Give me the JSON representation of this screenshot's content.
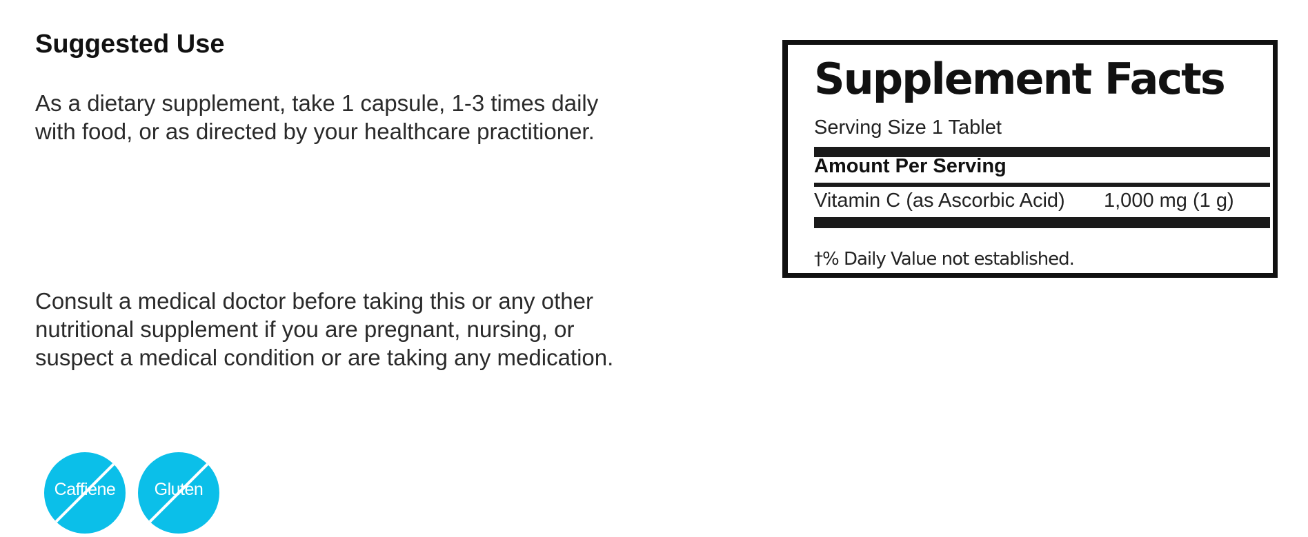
{
  "suggested_use": {
    "heading": "Suggested Use",
    "directions": "As a dietary supplement, take 1 capsule, 1-3 times daily with food, or as directed by your healthcare practitioner.",
    "warning": "Consult a medical doctor before taking this or any other nutritional supplement if you are pregnant, nursing, or suspect a medical condition or are taking any medication."
  },
  "badges": [
    {
      "label": "Caffiene",
      "icon": "no-caffeine-icon",
      "color": "#0bbfe9"
    },
    {
      "label": "Gluten",
      "icon": "no-gluten-icon",
      "color": "#0bbfe9"
    }
  ],
  "supplement_facts": {
    "title": "Supplement Facts",
    "serving_size": "Serving Size 1 Tablet",
    "amount_header": "Amount Per Serving",
    "nutrient_name": "Vitamin C (as Ascorbic Acid)",
    "nutrient_amount": "1,000 mg (1 g)",
    "footnote": "†% Daily Value not established."
  }
}
